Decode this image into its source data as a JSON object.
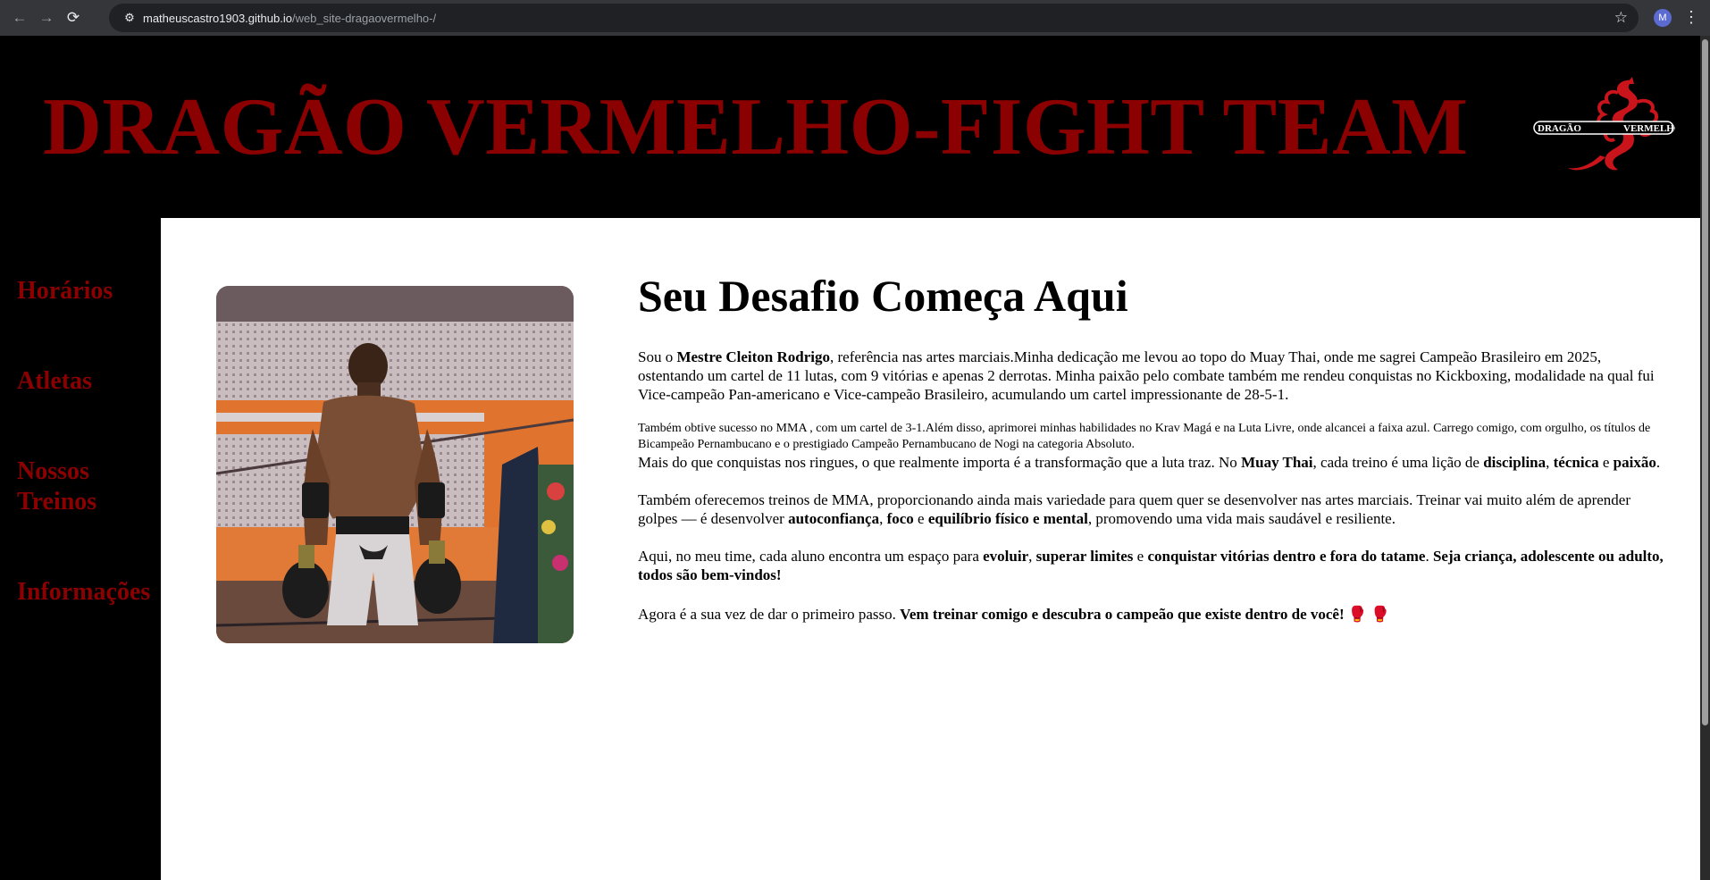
{
  "browser": {
    "back_icon": "←",
    "forward_icon": "→",
    "reload_icon": "⟳",
    "site_info_icon": "⚙",
    "url_host": "matheuscastro1903.github.io",
    "url_path": "/web_site-dragaovermelho-/",
    "bookmark_icon": "☆",
    "profile_initial": "M",
    "menu_icon": "⋮"
  },
  "header": {
    "title": "DRAGÃO VERMELHO-FIGHT TEAM",
    "logo_left_text": "DRAGÃO",
    "logo_right_text": "VERMELHO"
  },
  "sidebar": {
    "items": [
      {
        "label": "Horários"
      },
      {
        "label": "Atletas"
      },
      {
        "label": "Nossos Treinos"
      },
      {
        "label": "Informações"
      }
    ]
  },
  "main": {
    "headline": "Seu Desafio Começa Aqui",
    "p1": {
      "t1": "Sou o ",
      "b1": "Mestre Cleiton Rodrigo",
      "t2": ", referência nas artes marciais.Minha dedicação me levou ao topo do Muay Thai, onde me sagrei Campeão Brasileiro em 2025, ostentando um cartel de 11 lutas, com 9 vitórias e apenas 2 derrotas. Minha paixão pelo combate também me rendeu conquistas no Kickboxing, modalidade na qual fui Vice-campeão Pan-americano e Vice-campeão Brasileiro, acumulando um cartel impressionante de 28-5-1."
    },
    "p2": "Também obtive sucesso no MMA , com um cartel de 3-1.Além disso, aprimorei minhas habilidades no Krav Magá e na Luta Livre, onde alcancei a faixa azul. Carrego comigo, com orgulho, os títulos de Bicampeão Pernambucano e o prestigiado Campeão Pernambucano de Nogi na categoria Absoluto.",
    "p3": {
      "t1": "Mais do que conquistas nos ringues, o que realmente importa é a transformação que a luta traz. No ",
      "b1": "Muay Thai",
      "t2": ", cada treino é uma lição de ",
      "b2": "disciplina",
      "t3": ", ",
      "b3": "técnica",
      "t4": " e ",
      "b4": "paixão",
      "t5": "."
    },
    "p4": {
      "t1": "Também oferecemos treinos de MMA, proporcionando ainda mais variedade para quem quer se desenvolver nas artes marciais. Treinar vai muito além de aprender golpes — é desenvolver ",
      "b1": "autoconfiança",
      "t2": ", ",
      "b2": "foco",
      "t3": " e ",
      "b3": "equilíbrio físico e mental",
      "t4": ", promovendo uma vida mais saudável e resiliente."
    },
    "p5": {
      "t1": "Aqui, no meu time, cada aluno encontra um espaço para ",
      "b1": "evoluir",
      "t2": ", ",
      "b2": "superar limites",
      "t3": " e ",
      "b3": "conquistar vitórias dentro e fora do tatame",
      "t4": ". ",
      "b4": "Seja criança, adolescente ou adulto, todos são bem-vindos!"
    },
    "p6": {
      "t1": "Agora é a sua vez de dar o primeiro passo. ",
      "b1": "Vem treinar comigo e descubra o campeão que existe dentro de você!",
      "emoji": " 🥊 🥊"
    }
  },
  "colors": {
    "brand_red": "#8b0000",
    "background": "#000000",
    "content_bg": "#ffffff"
  }
}
